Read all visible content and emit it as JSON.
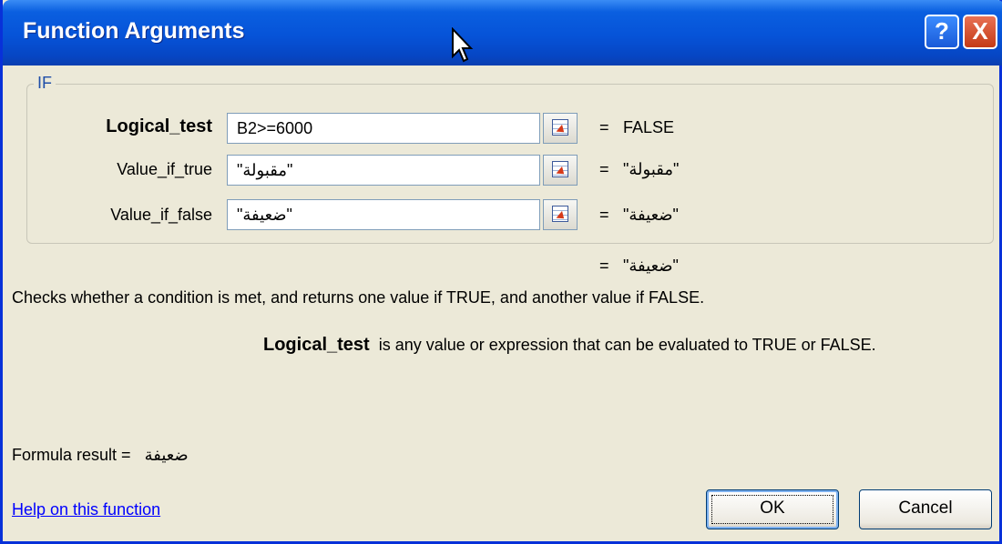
{
  "window": {
    "title": "Function Arguments",
    "help_button": "?",
    "close_button": "X"
  },
  "function_group": {
    "label": "IF",
    "arguments": [
      {
        "name": "Logical_test",
        "value": "B2>=6000",
        "result": "FALSE",
        "bold": true
      },
      {
        "name": "Value_if_true",
        "value": "\"مقبولة\"",
        "result": "\"مقبولة\"",
        "bold": false
      },
      {
        "name": "Value_if_false",
        "value": "\"ضعيفة\"",
        "result": "\"ضعيفة\"",
        "bold": false
      }
    ]
  },
  "function_result": "\"ضعيفة\"",
  "equals_sign": "=",
  "description": "Checks whether a condition is met, and returns one value if TRUE, and another value if FALSE.",
  "argument_help": {
    "name": "Logical_test",
    "text": "is any value or expression that can be evaluated to TRUE or FALSE."
  },
  "formula_result": {
    "label": "Formula result =",
    "value": "ضعيفة"
  },
  "help_link": "Help on this function",
  "buttons": {
    "ok": "OK",
    "cancel": "Cancel"
  },
  "icons": {
    "collapse_dialog": "collapse-dialog-icon",
    "cursor": "mouse-pointer-icon"
  }
}
